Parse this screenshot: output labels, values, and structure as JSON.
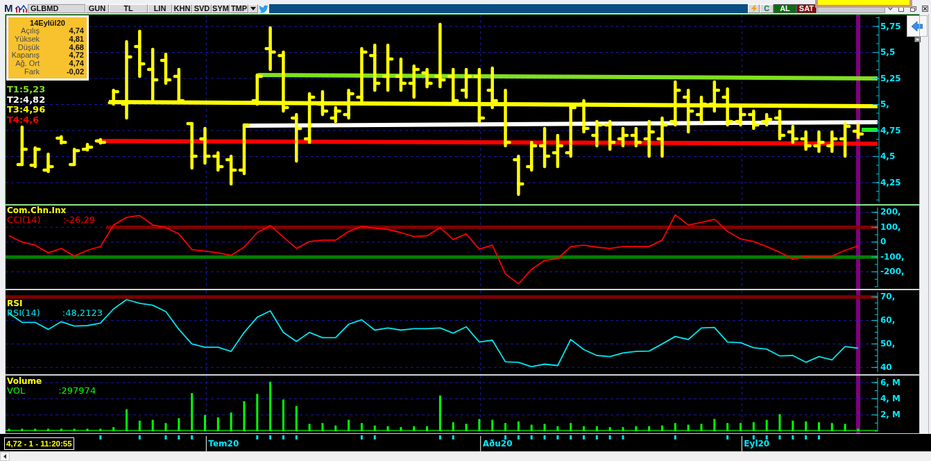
{
  "toolbar": {
    "logo": "M",
    "symbol": "GLBMD",
    "buttons": [
      "GUN",
      "TL",
      "LIN",
      "KHN",
      "SVD",
      "SYM",
      "TMP"
    ],
    "actions": [
      {
        "label": "C",
        "kind": "plain"
      },
      {
        "label": "AL",
        "kind": "buy"
      },
      {
        "label": "SAT",
        "kind": "sell"
      }
    ]
  },
  "price_chart": {
    "info": {
      "date": "14Eylül20",
      "rows": [
        {
          "label": "Açılış",
          "value": "4,74"
        },
        {
          "label": "Yüksek",
          "value": "4,81"
        },
        {
          "label": "Düşük",
          "value": "4,68"
        },
        {
          "label": "Kapanış",
          "value": "4,72"
        },
        {
          "label": "Ağ. Ort",
          "value": "4,74"
        },
        {
          "label": "Fark",
          "value": "-0,02"
        }
      ]
    },
    "trendlines": [
      {
        "label": "T1:5,23",
        "color": "#80e020"
      },
      {
        "label": "T2:4,82",
        "color": "#ffffff"
      },
      {
        "label": "T3:4,96",
        "color": "#ffff00"
      },
      {
        "label": "T4:4,6",
        "color": "#ff0000"
      }
    ],
    "y_axis_labels": [
      "5,75",
      "5,5",
      "5,25",
      "5,",
      "4,75",
      "4,5",
      "4,25"
    ]
  },
  "indicators": [
    {
      "reading": ":-26,29",
      "chart_data": {
        "type": "line",
        "title": "Com.Chn.Inx",
        "series": [
          {
            "name": "CCI(14)",
            "color": "#ff0000",
            "values": [
              43,
              0,
              -21,
              -72,
              -43,
              -94,
              -55,
              -30,
              115,
              166,
              179,
              115,
              98,
              55,
              -51,
              -60,
              -72,
              -89,
              -34,
              64,
              111,
              34,
              -43,
              4,
              13,
              13,
              72,
              106,
              94,
              85,
              64,
              38,
              43,
              98,
              17,
              55,
              -47,
              -21,
              -213,
              -281,
              -183,
              -123,
              -111,
              -30,
              -21,
              -34,
              -43,
              -30,
              -30,
              -30,
              13,
              183,
              115,
              132,
              153,
              72,
              21,
              4,
              -30,
              -68,
              -115,
              -94,
              -94,
              -94,
              -55,
              -26
            ]
          }
        ],
        "ylim": [
          -300,
          232
        ],
        "yticks": [
          {
            "value": 200,
            "label": "200,"
          },
          {
            "value": 100,
            "label": "100,"
          },
          {
            "value": 0,
            "label": "0"
          },
          {
            "value": -100,
            "label": "-100,"
          },
          {
            "value": -200,
            "label": "-200,"
          }
        ],
        "grid": true,
        "ref_lines": [
          {
            "axis": "y",
            "value": 100,
            "color": "#800000"
          },
          {
            "axis": "y",
            "value": -100,
            "color": "#008000"
          }
        ]
      }
    },
    {
      "reading": ":48,2123",
      "chart_data": {
        "type": "line",
        "title": "RSI",
        "series": [
          {
            "name": "RSI(14)",
            "color": "#00e5ee",
            "values": [
              63,
              59.2,
              59.2,
              56.2,
              59.5,
              57.6,
              57.8,
              58.9,
              64.9,
              68.9,
              67.3,
              66.5,
              63.8,
              56.2,
              50,
              48.6,
              48.6,
              46.8,
              54.9,
              61.4,
              64.1,
              54.9,
              51.1,
              54.9,
              52.7,
              52.7,
              58.4,
              60.3,
              55.9,
              56.8,
              55.9,
              56.5,
              56.5,
              56.8,
              54.6,
              57.3,
              50.8,
              51.6,
              42.4,
              42.2,
              40.3,
              41.4,
              40.8,
              51.9,
              47.6,
              45.1,
              44.6,
              46.2,
              46.8,
              47,
              50,
              53.2,
              51.9,
              56.8,
              57,
              50.8,
              50.5,
              48.4,
              47.8,
              44.9,
              45.1,
              42.2,
              44.6,
              43.2,
              48.9,
              48.2
            ]
          }
        ],
        "ylim": [
          38,
          72
        ],
        "yticks": [
          {
            "value": 70,
            "label": "70,"
          },
          {
            "value": 60,
            "label": "60,"
          },
          {
            "value": 50,
            "label": "50,"
          },
          {
            "value": 40,
            "label": "40"
          }
        ],
        "grid": true,
        "ref_lines": [
          {
            "axis": "y",
            "value": 70,
            "color": "#800000"
          }
        ]
      }
    },
    {
      "reading": ":297974",
      "chart_data": {
        "type": "bar",
        "title": "Volume",
        "series": [
          {
            "name": "VOL",
            "color": "#00ff00",
            "values": [
              0.3,
              0.3,
              0.3,
              0.3,
              0.3,
              0.3,
              0.3,
              0.3,
              0.5,
              2.7,
              1.3,
              1.4,
              1.0,
              1.6,
              4.7,
              2.0,
              1.7,
              2.3,
              3.7,
              4.6,
              6.1,
              3.9,
              3.1,
              0.9,
              1.0,
              0.7,
              1.4,
              1.0,
              0.7,
              0.6,
              0.5,
              0.6,
              0.6,
              4.4,
              1.1,
              0.9,
              1.5,
              1.4,
              1.0,
              1.2,
              0.8,
              0.9,
              0.6,
              1.0,
              0.6,
              0.6,
              0.5,
              0.5,
              0.6,
              0.6,
              0.7,
              1.0,
              0.8,
              0.9,
              1.5,
              1.0,
              1.0,
              1.1,
              1.4,
              2.1,
              1.3,
              1.2,
              1.1,
              1.0,
              0.9,
              0.3
            ]
          }
        ],
        "ylim": [
          0,
          6.6
        ],
        "yticks": [
          {
            "value": 6,
            "label": "6, M"
          },
          {
            "value": 4,
            "label": "4, M"
          },
          {
            "value": 2,
            "label": "2, M"
          }
        ],
        "grid": true
      }
    }
  ],
  "time_axis": {
    "status": "4,72 - 1 - 11:20:55",
    "months": [
      "Tem20",
      "Aðu20",
      "Eyl20"
    ]
  }
}
